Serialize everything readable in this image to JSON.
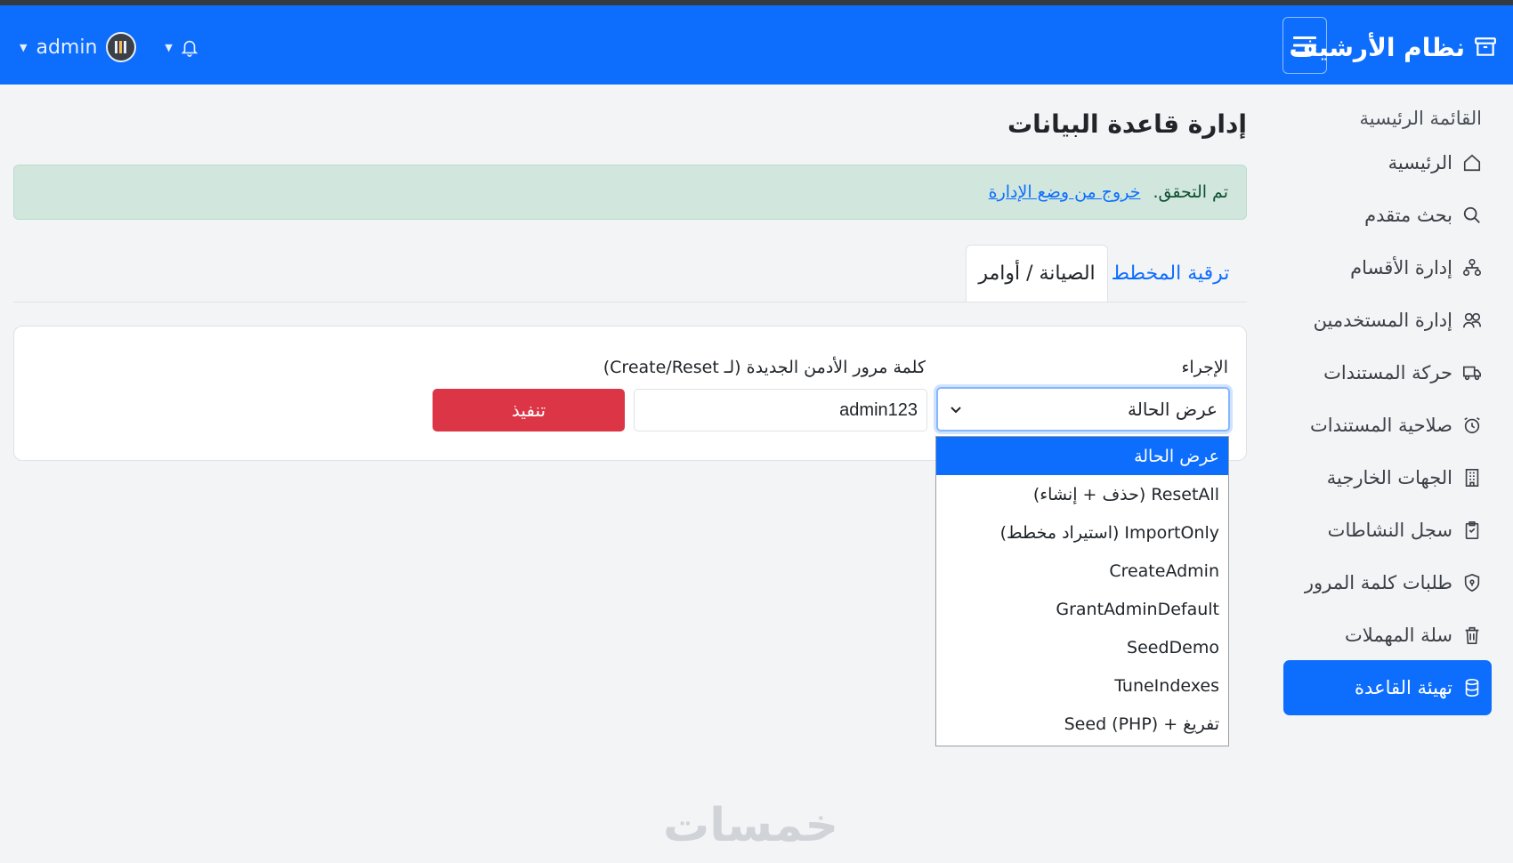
{
  "navbar": {
    "brand": "نظام الأرشيف",
    "user_name": "admin",
    "color": "#0d6efd"
  },
  "sidebar": {
    "heading": "القائمة الرئيسية",
    "items": [
      {
        "label": "الرئيسية",
        "icon": "home-icon"
      },
      {
        "label": "بحث متقدم",
        "icon": "search-icon"
      },
      {
        "label": "إدارة الأقسام",
        "icon": "sitemap-icon"
      },
      {
        "label": "إدارة المستخدمين",
        "icon": "users-icon"
      },
      {
        "label": "حركة المستندات",
        "icon": "truck-icon"
      },
      {
        "label": "صلاحية المستندات",
        "icon": "alarm-icon"
      },
      {
        "label": "الجهات الخارجية",
        "icon": "building-icon"
      },
      {
        "label": "سجل النشاطات",
        "icon": "clipboard-icon"
      },
      {
        "label": "طلبات كلمة المرور",
        "icon": "shield-icon"
      },
      {
        "label": "سلة المهملات",
        "icon": "trash-icon"
      },
      {
        "label": "تهيئة القاعدة",
        "icon": "database-icon",
        "active": true
      }
    ]
  },
  "main": {
    "title": "إدارة قاعدة البيانات",
    "alert": {
      "text": "تم التحقق.",
      "link": "خروج من وضع الإدارة"
    },
    "tabs": [
      {
        "label": "ترقية المخطط",
        "active": false
      },
      {
        "label": "الصيانة / أوامر",
        "active": true
      }
    ],
    "form": {
      "action_label": "الإجراء",
      "password_label": "كلمة مرور الأدمن الجديدة (لـ Create/Reset)",
      "selected_action": "عرض الحالة",
      "password_value": "admin123",
      "execute_label": "تنفيذ"
    },
    "dropdown_options": [
      "عرض الحالة",
      "ResetAll (حذف + إنشاء)",
      "ImportOnly (استيراد مخطط)",
      "CreateAdmin",
      "GrantAdminDefault",
      "SeedDemo",
      "TuneIndexes",
      "تفريغ + Seed (PHP)"
    ]
  },
  "watermark": "خمسات"
}
